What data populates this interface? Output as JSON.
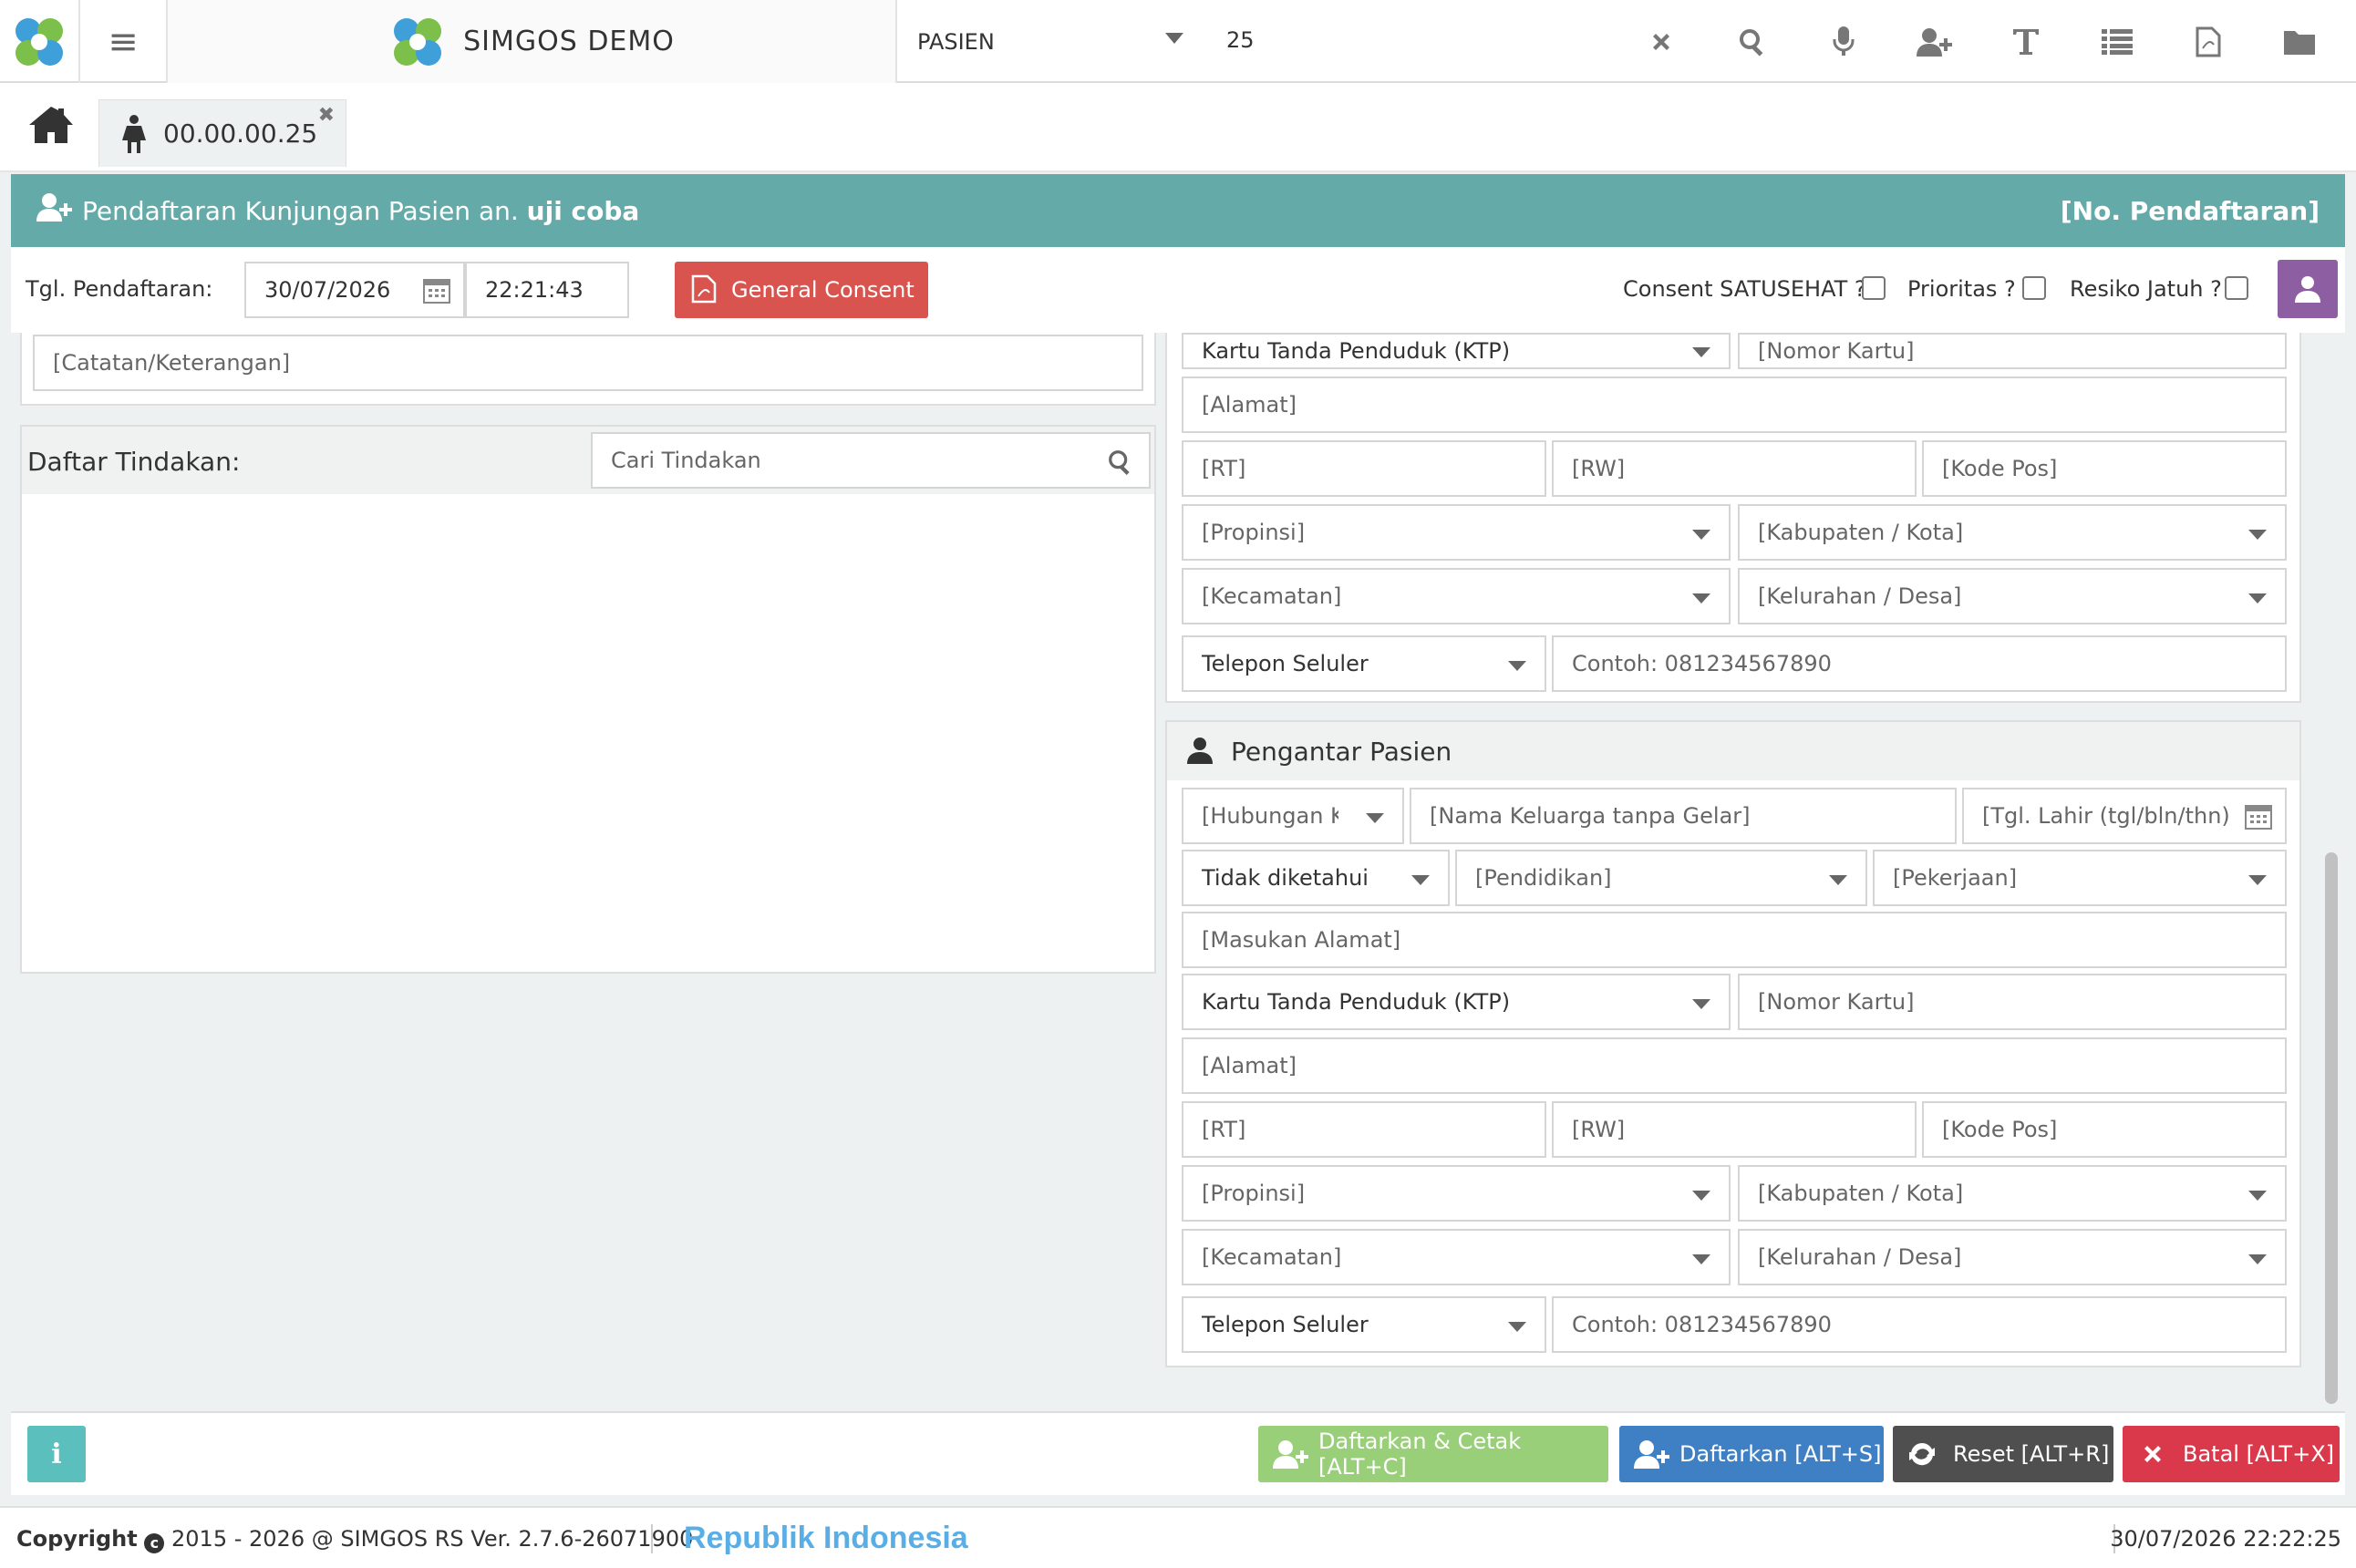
{
  "topbar": {
    "brand": "SIMGOS DEMO",
    "search_type": "PASIEN",
    "search_value": "25"
  },
  "tabs": {
    "patient_tab": "00.00.00.25"
  },
  "banner": {
    "title_prefix": "Pendaftaran Kunjungan Pasien an.",
    "patient_name": "uji coba",
    "right": "[No. Pendaftaran]"
  },
  "registration": {
    "label": "Tgl. Pendaftaran:",
    "date": "30/07/2026",
    "time": "22:21:43",
    "consent_button": "General Consent",
    "checks": [
      "Consent SATUSEHAT ?",
      "Prioritas ?",
      "Resiko Jatuh ?"
    ]
  },
  "left": {
    "notes_placeholder": "[Catatan/Keterangan]",
    "tindakan_title": "Daftar Tindakan:",
    "tindakan_search": "Cari Tindakan"
  },
  "address_top": {
    "id_type": "Kartu Tanda Penduduk (KTP)",
    "id_number": "[Nomor Kartu]",
    "alamat": "[Alamat]",
    "rt": "[RT]",
    "rw": "[RW]",
    "kodepos": "[Kode Pos]",
    "propinsi": "[Propinsi]",
    "kabupaten": "[Kabupaten / Kota]",
    "kecamatan": "[Kecamatan]",
    "kelurahan": "[Kelurahan / Desa]",
    "phone_type": "Telepon Seluler",
    "phone_placeholder": "Contoh: 081234567890"
  },
  "pengantar": {
    "title": "Pengantar Pasien",
    "hubungan": "[Hubungan Keluarga]",
    "nama": "[Nama Keluarga tanpa Gelar]",
    "tgl_lahir": "[Tgl. Lahir (tgl/bln/thn)]",
    "jk": "Tidak diketahui",
    "pendidikan": "[Pendidikan]",
    "pekerjaan": "[Pekerjaan]",
    "masukan_alamat": "[Masukan Alamat]",
    "id_type": "Kartu Tanda Penduduk (KTP)",
    "id_number": "[Nomor Kartu]",
    "alamat": "[Alamat]",
    "rt": "[RT]",
    "rw": "[RW]",
    "kodepos": "[Kode Pos]",
    "propinsi": "[Propinsi]",
    "kabupaten": "[Kabupaten / Kota]",
    "kecamatan": "[Kecamatan]",
    "kelurahan": "[Kelurahan / Desa]",
    "phone_type": "Telepon Seluler",
    "phone_placeholder": "Contoh: 081234567890"
  },
  "actions": {
    "info": "i",
    "daftar_cetak": "Daftarkan & Cetak [ALT+C]",
    "daftar": "Daftarkan [ALT+S]",
    "reset": "Reset [ALT+R]",
    "batal": "Batal [ALT+X]"
  },
  "colors": {
    "banner": "#64aaa8",
    "consent": "#d9534f",
    "daftar_cetak": "#99cf78",
    "daftar": "#3f7fc4",
    "reset": "#4f4f4f",
    "batal": "#d9394b",
    "purple": "#8e5ea2"
  },
  "footer": {
    "copyright_label": "Copyright",
    "copyright_text": "2015 - 2026 @ SIMGOS RS Ver. 2.7.6-26071900",
    "country": "Republik Indonesia",
    "datetime": "30/07/2026 22:22:25"
  }
}
